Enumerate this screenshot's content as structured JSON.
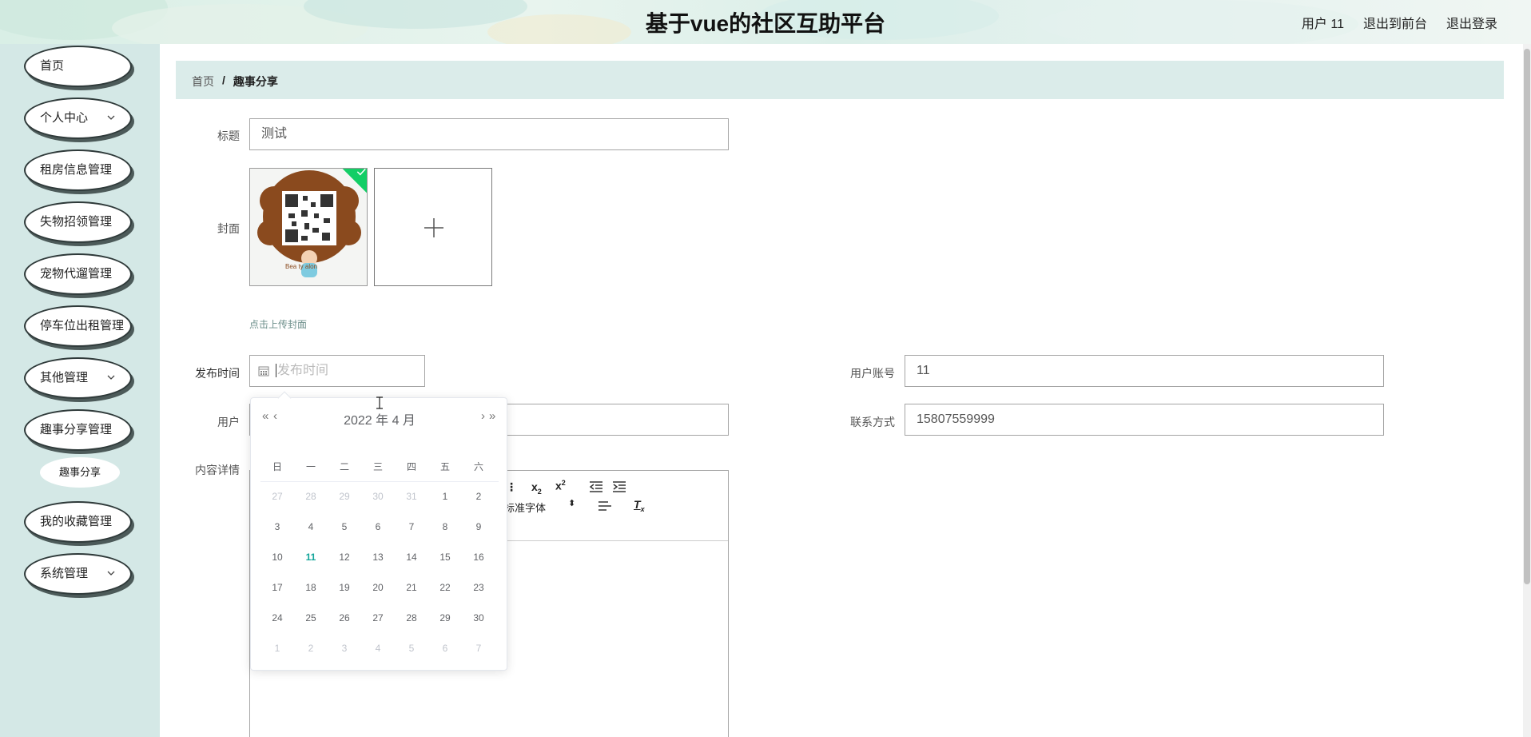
{
  "header": {
    "title": "基于vue的社区互助平台",
    "user_label": "用户 11",
    "front_link": "退出到前台",
    "logout_link": "退出登录"
  },
  "sidebar": {
    "items": [
      {
        "label": "首页",
        "has_chevron": false
      },
      {
        "label": "个人中心",
        "has_chevron": true
      },
      {
        "label": "租房信息管理",
        "has_chevron": false
      },
      {
        "label": "失物招领管理",
        "has_chevron": false
      },
      {
        "label": "宠物代遛管理",
        "has_chevron": false
      },
      {
        "label": "停车位出租管理",
        "has_chevron": false
      },
      {
        "label": "其他管理",
        "has_chevron": true
      },
      {
        "label": "趣事分享管理",
        "has_chevron": false
      },
      {
        "label": "我的收藏管理",
        "has_chevron": false
      },
      {
        "label": "系统管理",
        "has_chevron": true
      }
    ],
    "sub_item": "趣事分享"
  },
  "breadcrumb": {
    "home": "首页",
    "sep": "/",
    "current": "趣事分享"
  },
  "form": {
    "title_label": "标题",
    "title_value": "测试",
    "cover_label": "封面",
    "cover_hint": "点击上传封面",
    "cover_image_text": "Bea ty alon",
    "publish_time_label": "发布时间",
    "publish_time_placeholder": "发布时间",
    "user_account_label": "用户账号",
    "user_account_value": "11",
    "user_label": "用户",
    "contact_label": "联系方式",
    "contact_value": "15807559999",
    "content_label": "内容详情",
    "font_select": "标准字体"
  },
  "datepicker": {
    "header": "2022 年  4 月",
    "prev_year": "«",
    "prev_month": "‹",
    "next_month": "›",
    "next_year": "»",
    "weekdays": [
      "日",
      "一",
      "二",
      "三",
      "四",
      "五",
      "六"
    ],
    "weeks": [
      [
        {
          "d": "27",
          "off": true
        },
        {
          "d": "28",
          "off": true
        },
        {
          "d": "29",
          "off": true
        },
        {
          "d": "30",
          "off": true
        },
        {
          "d": "31",
          "off": true
        },
        {
          "d": "1"
        },
        {
          "d": "2"
        }
      ],
      [
        {
          "d": "3"
        },
        {
          "d": "4"
        },
        {
          "d": "5"
        },
        {
          "d": "6"
        },
        {
          "d": "7"
        },
        {
          "d": "8"
        },
        {
          "d": "9"
        }
      ],
      [
        {
          "d": "10"
        },
        {
          "d": "11",
          "today": true
        },
        {
          "d": "12"
        },
        {
          "d": "13"
        },
        {
          "d": "14"
        },
        {
          "d": "15"
        },
        {
          "d": "16"
        }
      ],
      [
        {
          "d": "17"
        },
        {
          "d": "18"
        },
        {
          "d": "19"
        },
        {
          "d": "20"
        },
        {
          "d": "21"
        },
        {
          "d": "22"
        },
        {
          "d": "23"
        }
      ],
      [
        {
          "d": "24"
        },
        {
          "d": "25"
        },
        {
          "d": "26"
        },
        {
          "d": "27"
        },
        {
          "d": "28"
        },
        {
          "d": "29"
        },
        {
          "d": "30"
        }
      ],
      [
        {
          "d": "1",
          "off": true
        },
        {
          "d": "2",
          "off": true
        },
        {
          "d": "3",
          "off": true
        },
        {
          "d": "4",
          "off": true
        },
        {
          "d": "5",
          "off": true
        },
        {
          "d": "6",
          "off": true
        },
        {
          "d": "7",
          "off": true
        }
      ]
    ]
  },
  "colors": {
    "sidebar_bg": "#d4e8e6",
    "breadcrumb_bg": "#dbecea",
    "today": "#13a59a",
    "success": "#13ce66"
  }
}
